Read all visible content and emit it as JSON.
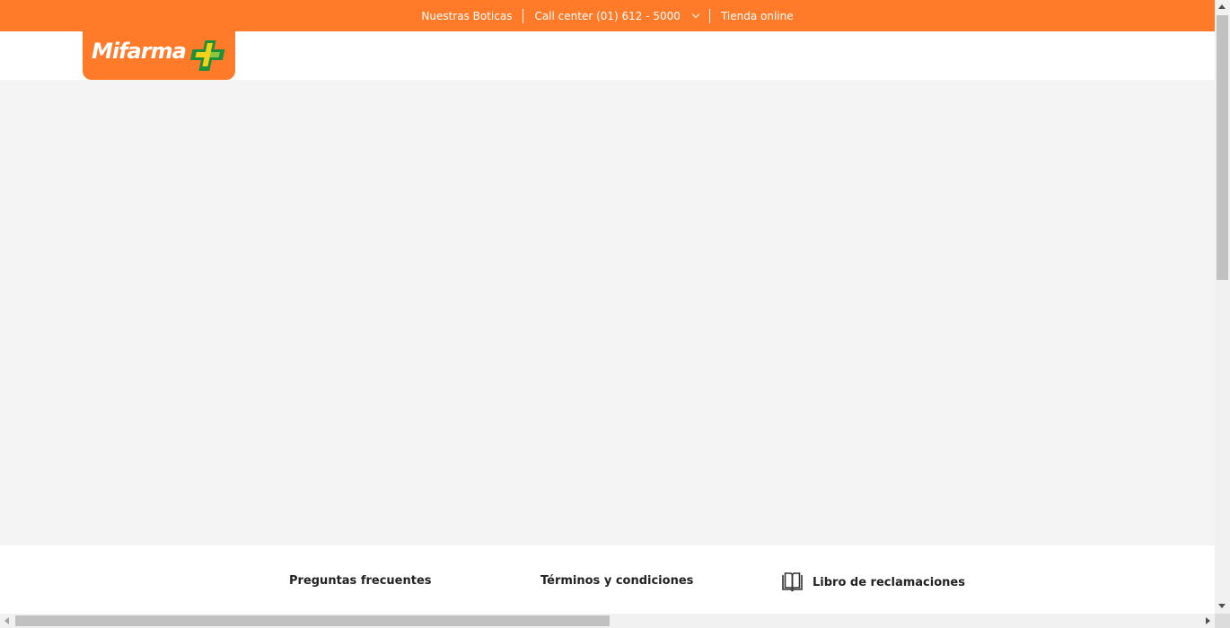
{
  "colors": {
    "brand_orange": "#ff7b2a",
    "content_bg": "#f4f4f4",
    "cross_green": "#1e8f3a",
    "cross_yellow": "#f2d21a"
  },
  "topnav": {
    "stores": "Nuestras Boticas",
    "call_center": "Call center (01) 612 - 5000",
    "online_store": "Tienda online"
  },
  "logo": {
    "text": "Mifarma",
    "icon": "cross-icon"
  },
  "footer": {
    "faq": "Preguntas frecuentes",
    "terms": "Términos y condiciones",
    "complaints": "Libro de reclamaciones",
    "complaints_icon": "book-icon"
  }
}
